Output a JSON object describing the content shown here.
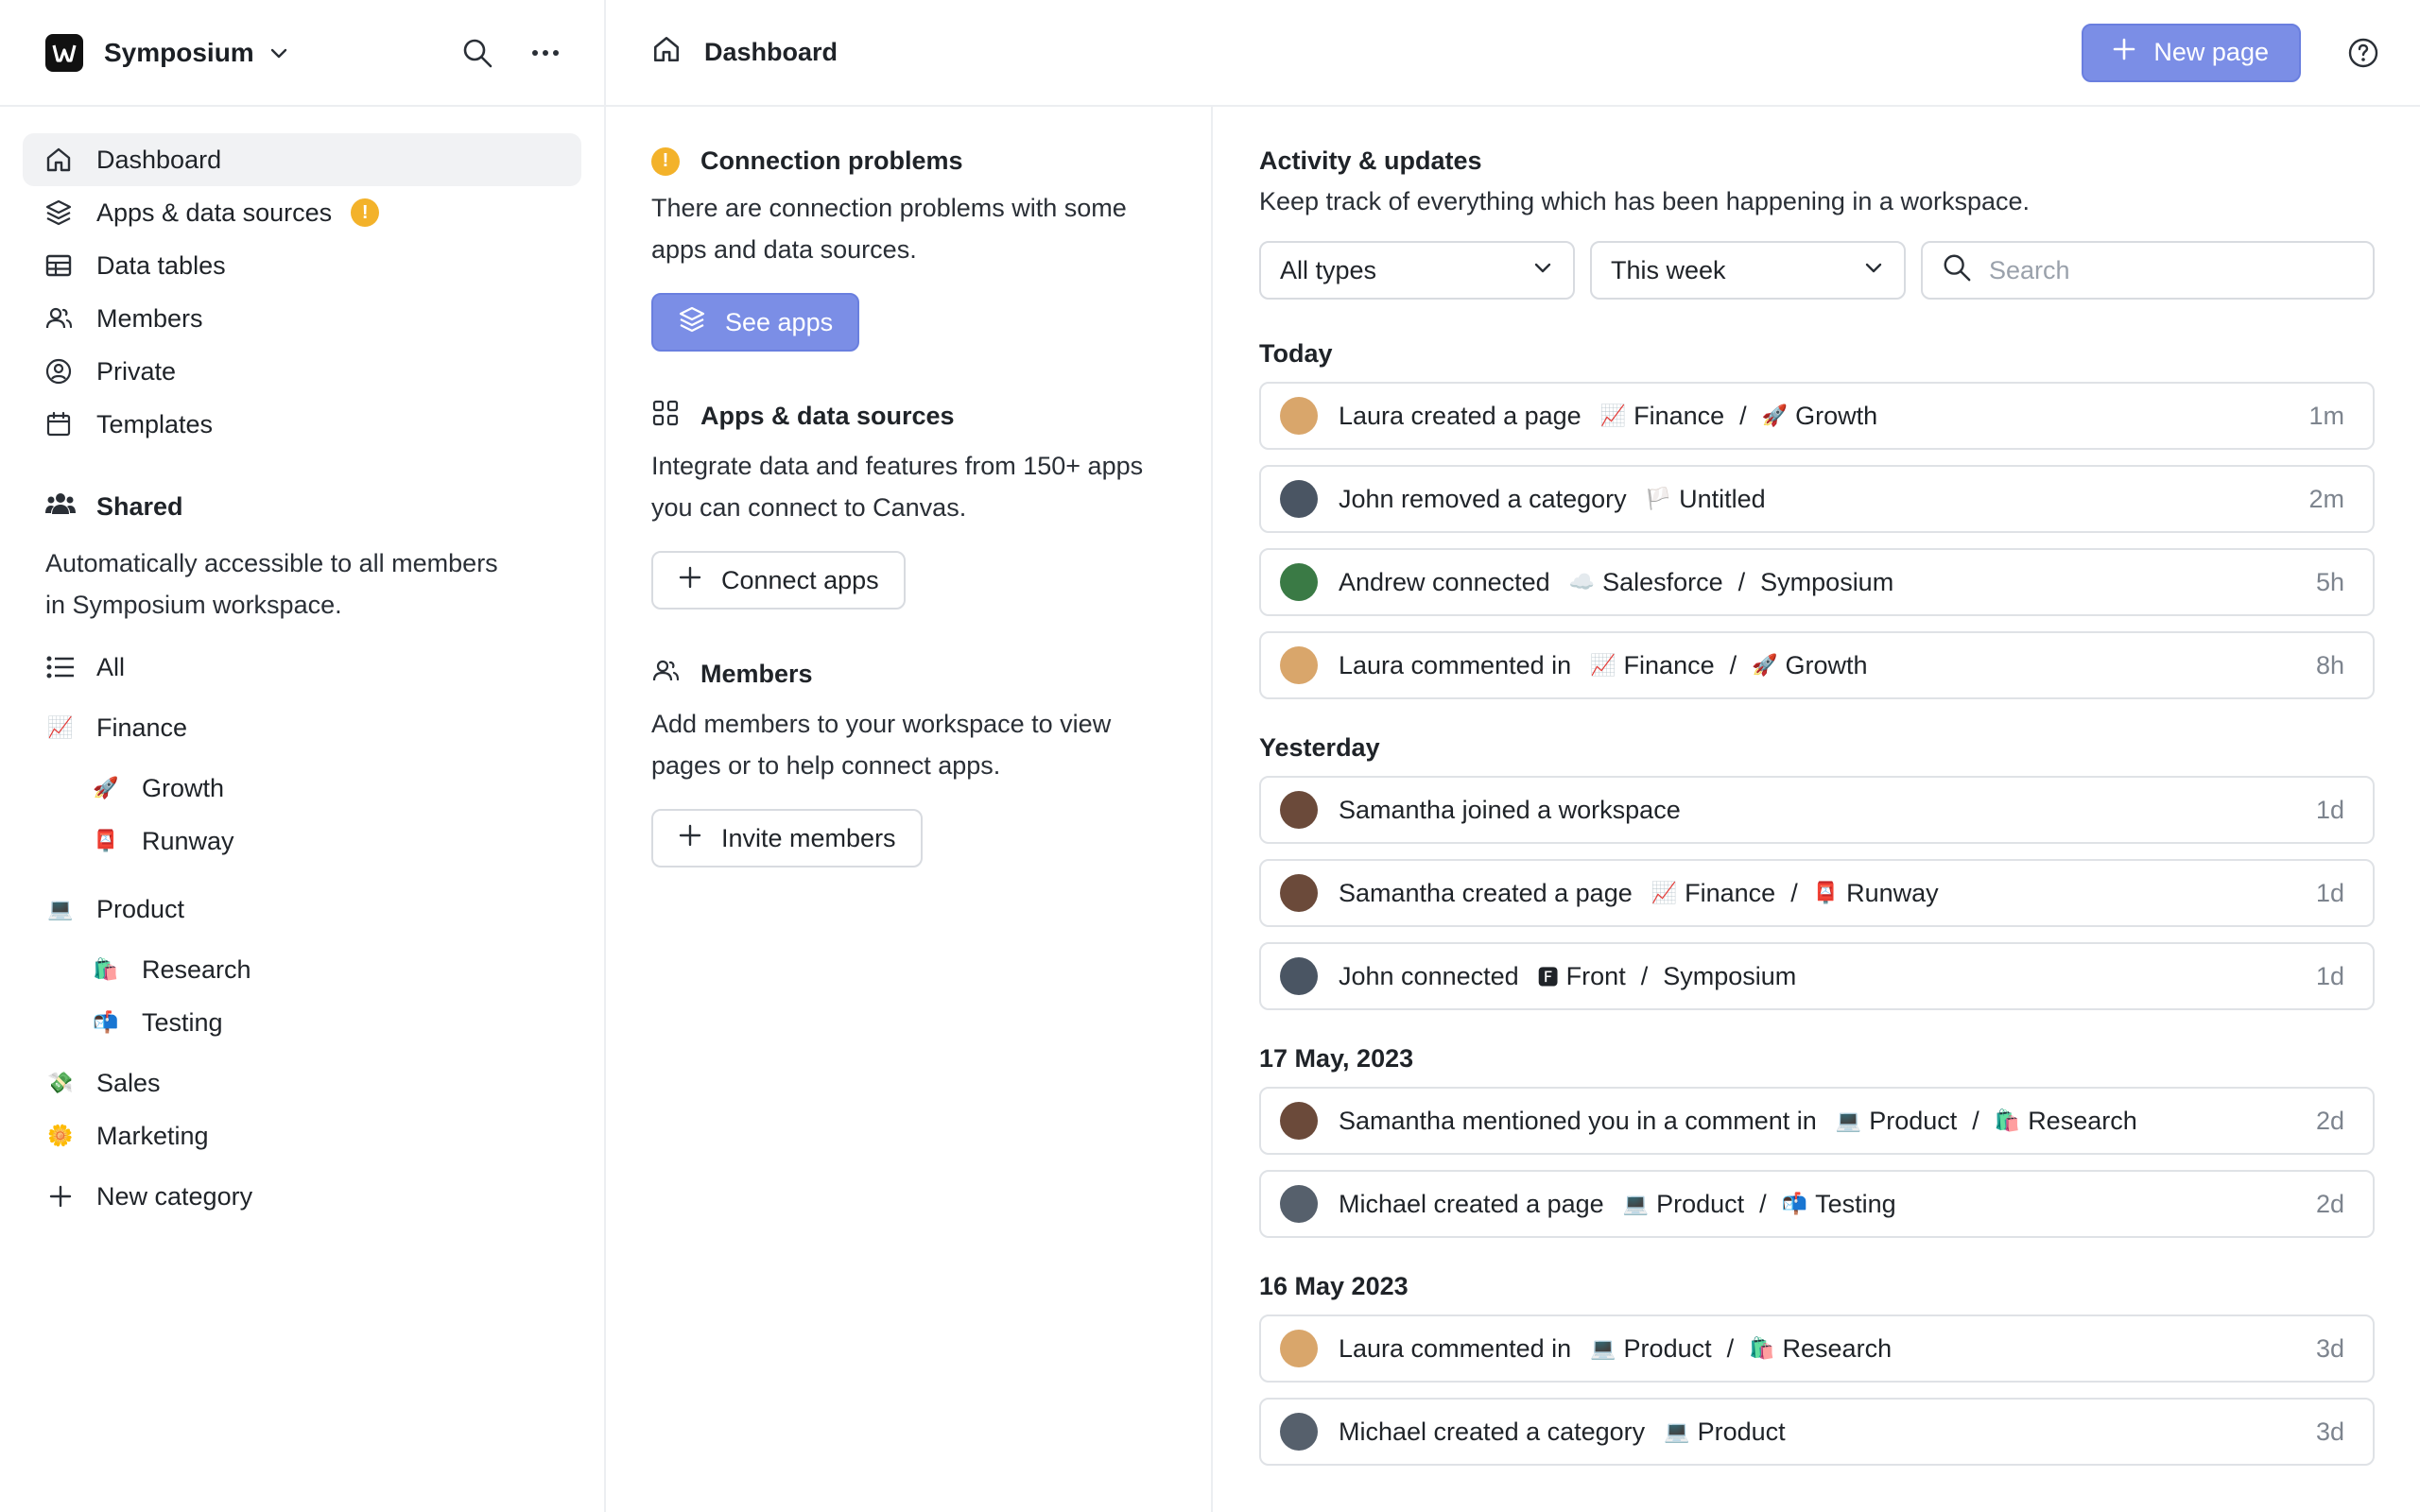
{
  "workspace": {
    "name": "Symposium"
  },
  "sidebar": {
    "nav": [
      {
        "label": "Dashboard",
        "icon": "home-icon",
        "active": true
      },
      {
        "label": "Apps & data sources",
        "icon": "layers-icon",
        "badge": "!"
      },
      {
        "label": "Data tables",
        "icon": "table-icon"
      },
      {
        "label": "Members",
        "icon": "members-icon"
      },
      {
        "label": "Private",
        "icon": "user-circle-icon"
      },
      {
        "label": "Templates",
        "icon": "calendar-icon"
      }
    ],
    "shared_title": "Shared",
    "shared_desc": "Automatically accessible to all members in Symposium workspace.",
    "categories": [
      {
        "label": "All",
        "emoji": "list-icon"
      },
      {
        "label": "Finance",
        "emoji": "📈"
      },
      {
        "label": "Growth",
        "emoji": "🚀",
        "sub": true
      },
      {
        "label": "Runway",
        "emoji": "📮",
        "sub": true
      },
      {
        "label": "Product",
        "emoji": "💻"
      },
      {
        "label": "Research",
        "emoji": "🛍️",
        "sub": true
      },
      {
        "label": "Testing",
        "emoji": "📬",
        "sub": true
      },
      {
        "label": "Sales",
        "emoji": "💸"
      },
      {
        "label": "Marketing",
        "emoji": "🌼"
      },
      {
        "label": "New category",
        "emoji": "plus-icon"
      }
    ]
  },
  "topbar": {
    "title": "Dashboard",
    "new_page_label": "New page"
  },
  "middle": {
    "connection": {
      "title": "Connection problems",
      "desc": "There are connection problems with some apps and data sources.",
      "button": "See apps"
    },
    "apps": {
      "title": "Apps & data sources",
      "desc": "Integrate data and features from 150+ apps you can connect to Canvas.",
      "button": "Connect apps"
    },
    "members": {
      "title": "Members",
      "desc": "Add members to your workspace to view pages or to help connect apps.",
      "button": "Invite members"
    }
  },
  "activity": {
    "title": "Activity & updates",
    "desc": "Keep track of everything which has been happening in a workspace.",
    "filter_type": "All types",
    "filter_time": "This week",
    "search_placeholder": "Search",
    "groups": [
      {
        "title": "Today",
        "rows": [
          {
            "avatar_color": "#d9a66b",
            "text": "Laura created a page",
            "crumbs": [
              {
                "emoji": "📈",
                "label": "Finance"
              },
              {
                "emoji": "🚀",
                "label": "Growth"
              }
            ],
            "time": "1m"
          },
          {
            "avatar_color": "#4a5563",
            "text": "John removed a category",
            "crumbs": [
              {
                "emoji": "🏳️",
                "label": "Untitled"
              }
            ],
            "time": "2m"
          },
          {
            "avatar_color": "#3a7a45",
            "text": "Andrew connected",
            "crumbs": [
              {
                "emoji": "☁️",
                "label": "Salesforce"
              },
              {
                "emoji": "",
                "label": "Symposium"
              }
            ],
            "time": "5h"
          },
          {
            "avatar_color": "#d9a66b",
            "text": "Laura commented in",
            "crumbs": [
              {
                "emoji": "📈",
                "label": "Finance"
              },
              {
                "emoji": "🚀",
                "label": "Growth"
              }
            ],
            "time": "8h"
          }
        ]
      },
      {
        "title": "Yesterday",
        "rows": [
          {
            "avatar_color": "#6b4a3a",
            "text": "Samantha joined a workspace",
            "crumbs": [],
            "time": "1d"
          },
          {
            "avatar_color": "#6b4a3a",
            "text": "Samantha created a page",
            "crumbs": [
              {
                "emoji": "📈",
                "label": "Finance"
              },
              {
                "emoji": "📮",
                "label": "Runway"
              }
            ],
            "time": "1d"
          },
          {
            "avatar_color": "#4a5563",
            "text": "John connected",
            "crumbs": [
              {
                "emoji": "🅵",
                "label": "Front"
              },
              {
                "emoji": "",
                "label": "Symposium"
              }
            ],
            "time": "1d"
          }
        ]
      },
      {
        "title": "17 May, 2023",
        "rows": [
          {
            "avatar_color": "#6b4a3a",
            "text": "Samantha mentioned you in a comment in",
            "crumbs": [
              {
                "emoji": "💻",
                "label": "Product"
              },
              {
                "emoji": "🛍️",
                "label": "Research"
              }
            ],
            "time": "2d"
          },
          {
            "avatar_color": "#56606c",
            "text": "Michael created a page",
            "crumbs": [
              {
                "emoji": "💻",
                "label": "Product"
              },
              {
                "emoji": "📬",
                "label": "Testing"
              }
            ],
            "time": "2d"
          }
        ]
      },
      {
        "title": "16 May 2023",
        "rows": [
          {
            "avatar_color": "#d9a66b",
            "text": "Laura commented in",
            "crumbs": [
              {
                "emoji": "💻",
                "label": "Product"
              },
              {
                "emoji": "🛍️",
                "label": "Research"
              }
            ],
            "time": "3d"
          },
          {
            "avatar_color": "#56606c",
            "text": "Michael created a category",
            "crumbs": [
              {
                "emoji": "💻",
                "label": "Product"
              }
            ],
            "time": "3d"
          }
        ]
      }
    ]
  }
}
